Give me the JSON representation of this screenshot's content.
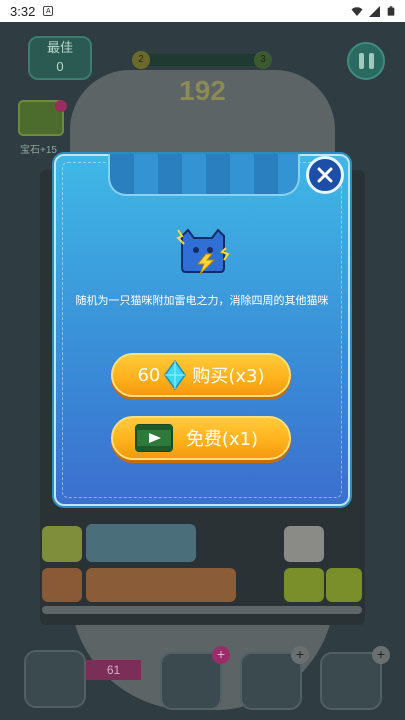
{
  "status_bar": {
    "time": "3:32"
  },
  "hud": {
    "best_label": "最佳",
    "best_value": "0",
    "level_start": "2",
    "level_end": "3",
    "progress_fraction": 0.08,
    "score": "192",
    "gem_label": "宝石+15"
  },
  "toolbar": {
    "item_count": "61"
  },
  "modal": {
    "description": "随机为一只猫咪附加雷电之力，消除四周的其他猫咪",
    "buy_price": "60",
    "buy_label": "购买(x3)",
    "free_label": "免费(x1)"
  },
  "colors": {
    "modal_top": "#3fb8e6",
    "modal_bottom": "#3b6fcf",
    "button": "#ffb01a"
  },
  "icons": [
    "close-icon",
    "lightning-cat-icon",
    "diamond-icon",
    "video-icon",
    "pause-icon",
    "plus-icon"
  ]
}
